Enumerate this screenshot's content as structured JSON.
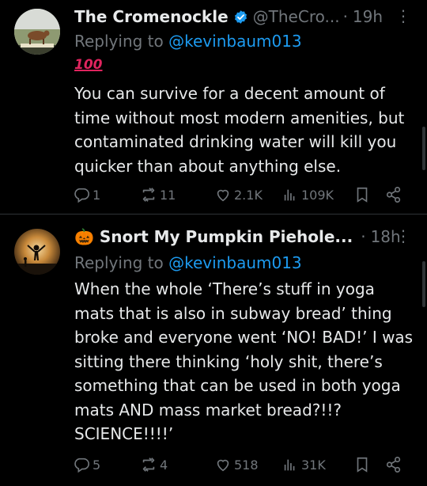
{
  "tweets": [
    {
      "name": "The Cromenockle",
      "handle": "@TheCro...",
      "dot": "·",
      "time": "19h",
      "reply_prefix": "Replying to",
      "reply_to": "@kevinbaum013",
      "emoji": "100",
      "text": "You can survive for a decent amount of time without most modern amenities, but contaminated drinking water will kill you quicker than about anything else.",
      "stats": {
        "replies": "1",
        "retweets": "11",
        "likes": "2.1K",
        "views": "109K"
      },
      "verified": true,
      "avatar_icon": "cow-avatar"
    },
    {
      "name": "🎃 Snort My Pumpkin Piehole...",
      "handle": "",
      "dot": "·",
      "time": "18h",
      "reply_prefix": "Replying to",
      "reply_to": "@kevinbaum013",
      "text": "When the whole ‘There’s stuff in yoga mats that is also in subway bread’ thing broke and everyone went ‘NO! BAD!’ I was sitting there thinking ‘holy shit, there’s something that can be used in both yoga mats AND mass market bread?!!? SCIENCE!!!!’",
      "stats": {
        "replies": "5",
        "retweets": "4",
        "likes": "518",
        "views": "31K"
      },
      "verified": false,
      "avatar_icon": "sunset-silhouette-avatar"
    }
  ],
  "colors": {
    "background": "#000000",
    "text": "#e7e9ea",
    "muted": "#71767b",
    "link": "#1d9bf0",
    "verified": "#1d9bf0"
  }
}
